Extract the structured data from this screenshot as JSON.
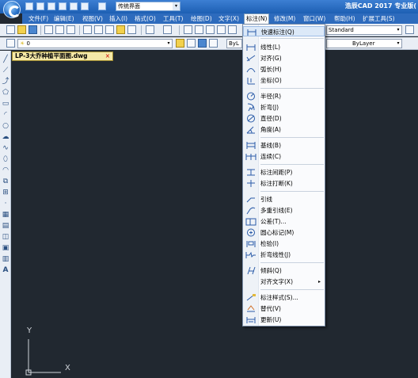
{
  "titlebar": {
    "workspace": "传统界面",
    "app_title": "浩辰CAD 2017 专业版("
  },
  "menubar": {
    "items": [
      "文件(F)",
      "编辑(E)",
      "视图(V)",
      "插入(I)",
      "格式(O)",
      "工具(T)",
      "绘图(D)",
      "文字(X)",
      "标注(N)",
      "修改(M)",
      "窗口(W)",
      "帮助(H)",
      "扩展工具(S)"
    ],
    "active_index": 8
  },
  "toolbar": {
    "textstyle": "Standard",
    "layer": "0",
    "color": "ByL",
    "linetype": "ByLayer"
  },
  "document": {
    "tab_name": "LP-3大乔种植平面图.dwg",
    "close": "×"
  },
  "ucs": {
    "y": "Y",
    "x": "X"
  },
  "dropdown": {
    "items": [
      {
        "label": "快速标注(Q)",
        "icon": "quick-dim-icon"
      },
      {
        "label": "线性(L)",
        "icon": "linear-dim-icon"
      },
      {
        "label": "对齐(G)",
        "icon": "aligned-dim-icon"
      },
      {
        "label": "弧长(H)",
        "icon": "arc-length-icon"
      },
      {
        "label": "坐标(O)",
        "icon": "ordinate-dim-icon"
      },
      {
        "label": "半径(R)",
        "icon": "radius-dim-icon"
      },
      {
        "label": "折弯(J)",
        "icon": "jogged-dim-icon"
      },
      {
        "label": "直径(D)",
        "icon": "diameter-dim-icon"
      },
      {
        "label": "角度(A)",
        "icon": "angular-dim-icon"
      },
      {
        "label": "基线(B)",
        "icon": "baseline-dim-icon"
      },
      {
        "label": "连续(C)",
        "icon": "continue-dim-icon"
      },
      {
        "label": "标注间距(P)",
        "icon": "dim-space-icon"
      },
      {
        "label": "标注打断(K)",
        "icon": "dim-break-icon"
      },
      {
        "label": "引线",
        "icon": "leader-icon"
      },
      {
        "label": "多重引线(E)",
        "icon": "multileader-icon"
      },
      {
        "label": "公差(T)...",
        "icon": "tolerance-icon"
      },
      {
        "label": "圆心标记(M)",
        "icon": "center-mark-icon"
      },
      {
        "label": "检验(I)",
        "icon": "inspection-icon"
      },
      {
        "label": "折弯线性(J)",
        "icon": "jogged-linear-icon"
      },
      {
        "label": "倾斜(Q)",
        "icon": "oblique-icon"
      },
      {
        "label": "对齐文字(X)",
        "icon": ""
      },
      {
        "label": "标注样式(S)...",
        "icon": "dim-style-icon"
      },
      {
        "label": "替代(V)",
        "icon": "override-icon"
      },
      {
        "label": "更新(U)",
        "icon": "update-icon"
      }
    ],
    "submenu_arrow": "▸"
  }
}
